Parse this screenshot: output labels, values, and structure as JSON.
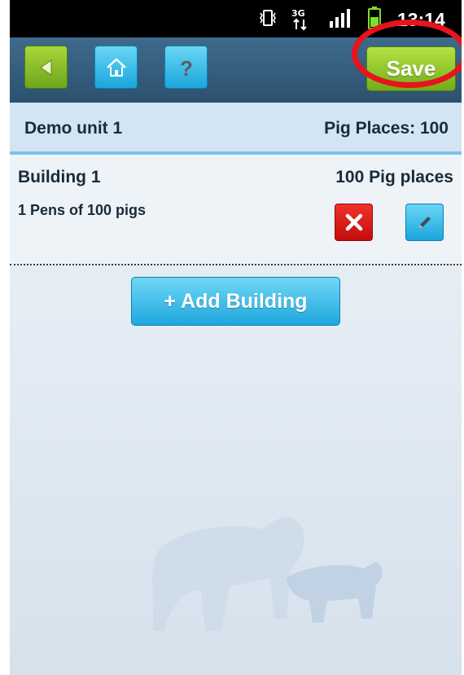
{
  "status_bar": {
    "time": "13:14",
    "icons": [
      "vibrate-icon",
      "3g-data-icon",
      "signal-icon",
      "battery-icon"
    ]
  },
  "toolbar": {
    "back_icon": "back-arrow-icon",
    "home_icon": "home-icon",
    "help_icon": "help-icon",
    "save_label": "Save"
  },
  "unit": {
    "name": "Demo unit 1",
    "pig_places": "Pig Places: 100"
  },
  "buildings": [
    {
      "name": "Building 1",
      "places": "100 Pig places",
      "pens": "1 Pens of 100 pigs"
    }
  ],
  "add_building_label": "+ Add Building",
  "colors": {
    "green_button": "#8cc22a",
    "blue_button": "#29b2e4",
    "delete_button": "#e01f1f",
    "toolbar": "#365e7f",
    "highlight_ring": "#e8131b"
  }
}
